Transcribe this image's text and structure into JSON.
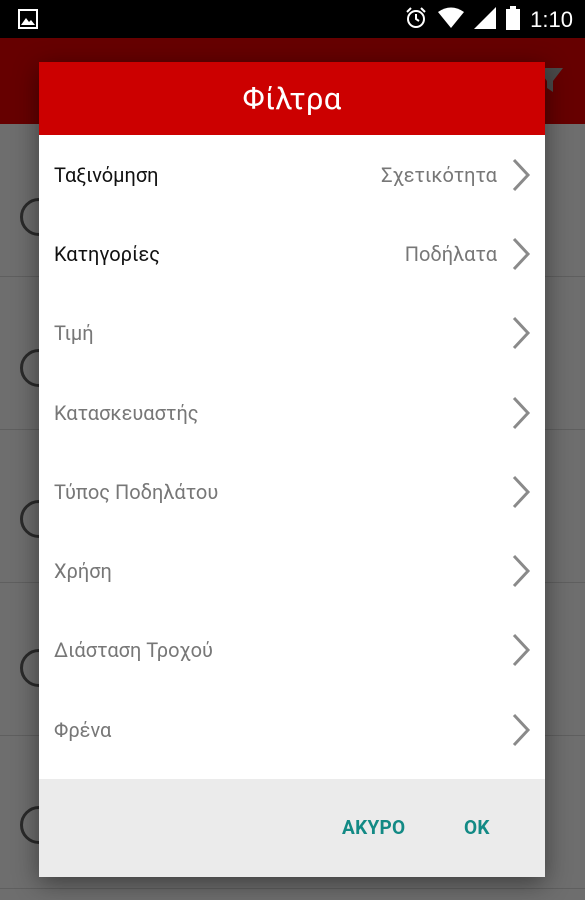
{
  "status_bar": {
    "time": "1:10",
    "icons": [
      "image-icon",
      "alarm-icon",
      "wifi-icon",
      "signal-icon",
      "battery-icon"
    ]
  },
  "dialog": {
    "title": "Φίλτρα",
    "filters": [
      {
        "label": "Ταξινόμηση",
        "value": "Σχετικότητα",
        "active": true
      },
      {
        "label": "Κατηγορίες",
        "value": "Ποδήλατα",
        "active": true
      },
      {
        "label": "Τιμή",
        "value": "",
        "active": false
      },
      {
        "label": "Κατασκευαστής",
        "value": "",
        "active": false
      },
      {
        "label": "Τύπος Ποδηλάτου",
        "value": "",
        "active": false
      },
      {
        "label": "Χρήση",
        "value": "",
        "active": false
      },
      {
        "label": "Διάσταση Τροχού",
        "value": "",
        "active": false
      },
      {
        "label": "Φρένα",
        "value": "",
        "active": false
      }
    ],
    "cancel_label": "ΑΚΥΡΟ",
    "ok_label": "OK"
  },
  "colors": {
    "header": "#cc0000",
    "accent_button": "#138a85",
    "active_text": "#111111",
    "inactive_text": "#777777"
  }
}
